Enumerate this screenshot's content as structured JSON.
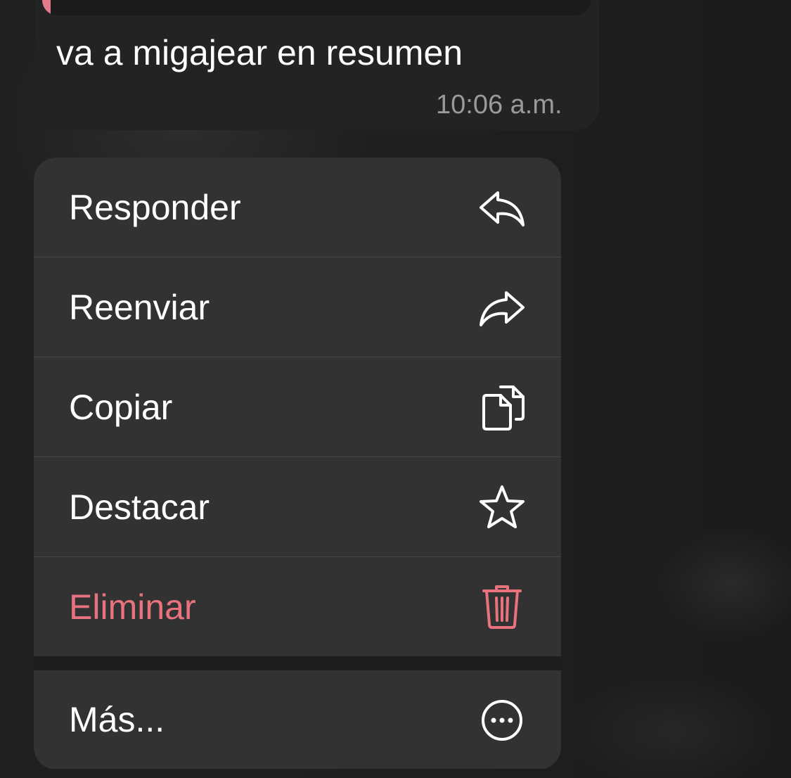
{
  "message": {
    "text": "va a migajear en resumen",
    "time": "10:06 a.m."
  },
  "menu": {
    "items": [
      {
        "label": "Responder",
        "icon": "reply-icon"
      },
      {
        "label": "Reenviar",
        "icon": "forward-icon"
      },
      {
        "label": "Copiar",
        "icon": "copy-icon"
      },
      {
        "label": "Destacar",
        "icon": "star-icon"
      },
      {
        "label": "Eliminar",
        "icon": "trash-icon",
        "color": "#e8737f"
      }
    ],
    "more": {
      "label": "Más...",
      "icon": "more-icon"
    }
  },
  "colors": {
    "accent_quote": "#e27c8a",
    "danger": "#e8737f",
    "menu_bg": "#323233",
    "bubble_bg": "#232324"
  }
}
